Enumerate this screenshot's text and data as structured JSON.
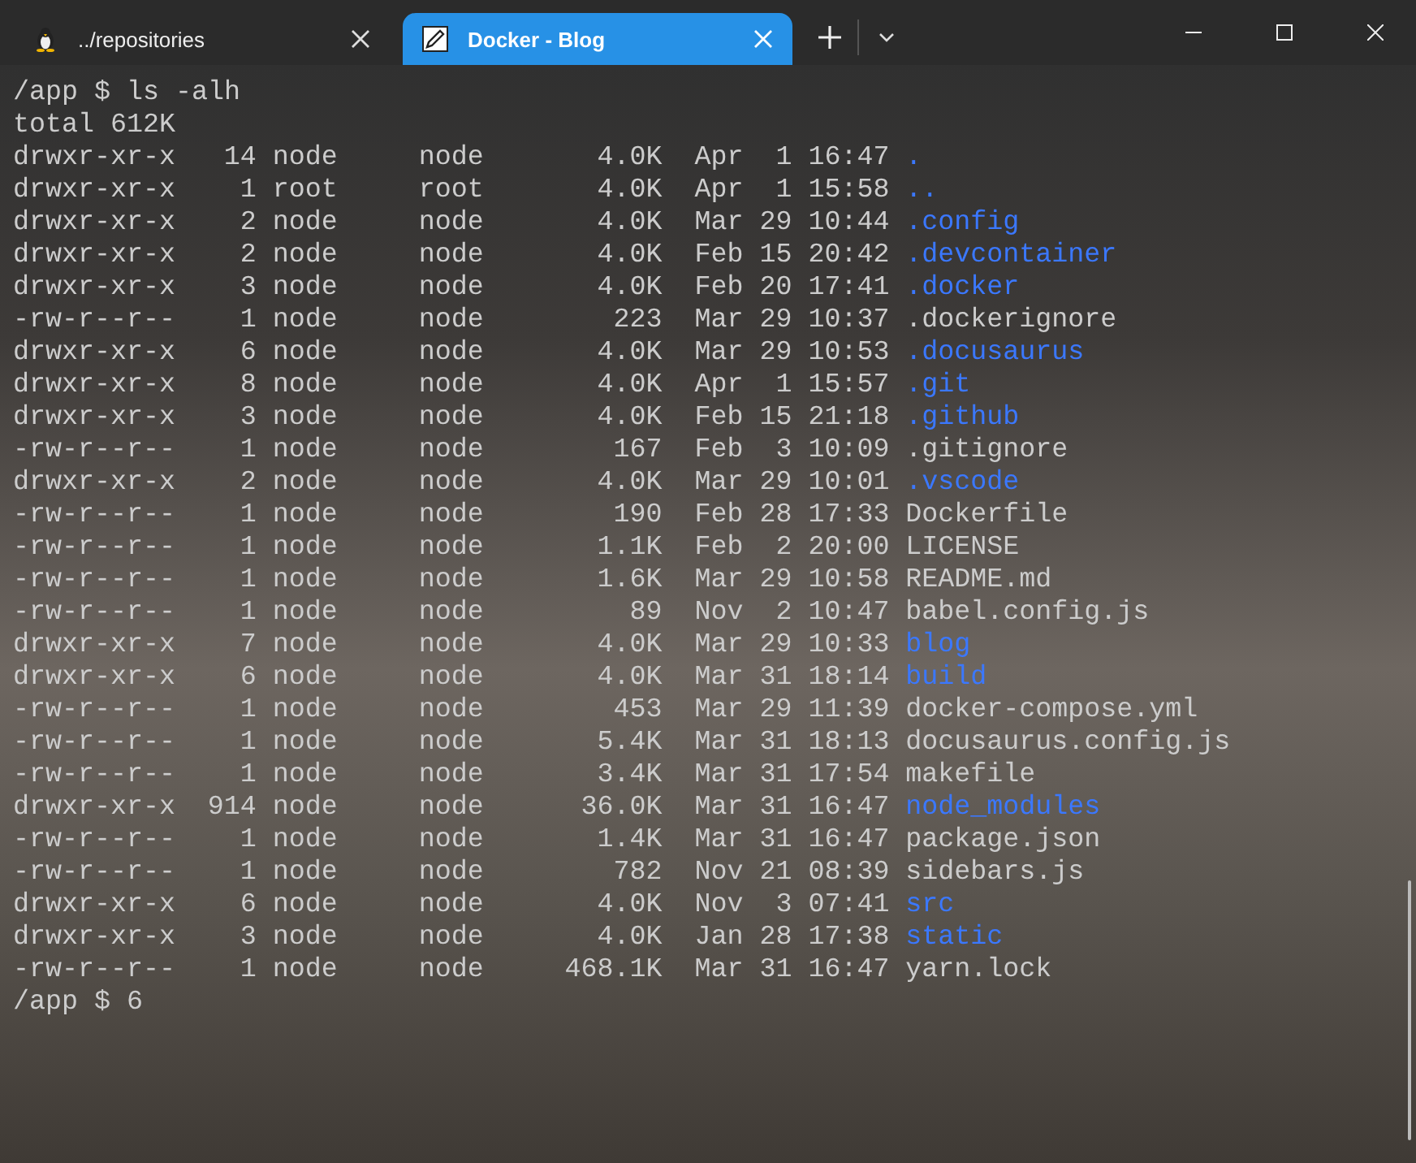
{
  "tabs": [
    {
      "title": "../repositories",
      "selected": false
    },
    {
      "title": "Docker - Blog",
      "selected": true
    }
  ],
  "terminal": {
    "command": "/app $ ls -alh",
    "total": "total 612K",
    "entries": [
      {
        "permissions": "drwxr-xr-x",
        "links": "14",
        "owner": "node",
        "group": "node",
        "size": "4.0K",
        "date": "Apr  1 16:47",
        "name": ".",
        "kind": "dir"
      },
      {
        "permissions": "drwxr-xr-x",
        "links": "1",
        "owner": "root",
        "group": "root",
        "size": "4.0K",
        "date": "Apr  1 15:58",
        "name": "..",
        "kind": "dir"
      },
      {
        "permissions": "drwxr-xr-x",
        "links": "2",
        "owner": "node",
        "group": "node",
        "size": "4.0K",
        "date": "Mar 29 10:44",
        "name": ".config",
        "kind": "dir"
      },
      {
        "permissions": "drwxr-xr-x",
        "links": "2",
        "owner": "node",
        "group": "node",
        "size": "4.0K",
        "date": "Feb 15 20:42",
        "name": ".devcontainer",
        "kind": "dir"
      },
      {
        "permissions": "drwxr-xr-x",
        "links": "3",
        "owner": "node",
        "group": "node",
        "size": "4.0K",
        "date": "Feb 20 17:41",
        "name": ".docker",
        "kind": "dir"
      },
      {
        "permissions": "-rw-r--r--",
        "links": "1",
        "owner": "node",
        "group": "node",
        "size": "223",
        "date": "Mar 29 10:37",
        "name": ".dockerignore",
        "kind": "file"
      },
      {
        "permissions": "drwxr-xr-x",
        "links": "6",
        "owner": "node",
        "group": "node",
        "size": "4.0K",
        "date": "Mar 29 10:53",
        "name": ".docusaurus",
        "kind": "dir"
      },
      {
        "permissions": "drwxr-xr-x",
        "links": "8",
        "owner": "node",
        "group": "node",
        "size": "4.0K",
        "date": "Apr  1 15:57",
        "name": ".git",
        "kind": "dir"
      },
      {
        "permissions": "drwxr-xr-x",
        "links": "3",
        "owner": "node",
        "group": "node",
        "size": "4.0K",
        "date": "Feb 15 21:18",
        "name": ".github",
        "kind": "dir"
      },
      {
        "permissions": "-rw-r--r--",
        "links": "1",
        "owner": "node",
        "group": "node",
        "size": "167",
        "date": "Feb  3 10:09",
        "name": ".gitignore",
        "kind": "file"
      },
      {
        "permissions": "drwxr-xr-x",
        "links": "2",
        "owner": "node",
        "group": "node",
        "size": "4.0K",
        "date": "Mar 29 10:01",
        "name": ".vscode",
        "kind": "dir"
      },
      {
        "permissions": "-rw-r--r--",
        "links": "1",
        "owner": "node",
        "group": "node",
        "size": "190",
        "date": "Feb 28 17:33",
        "name": "Dockerfile",
        "kind": "file"
      },
      {
        "permissions": "-rw-r--r--",
        "links": "1",
        "owner": "node",
        "group": "node",
        "size": "1.1K",
        "date": "Feb  2 20:00",
        "name": "LICENSE",
        "kind": "file"
      },
      {
        "permissions": "-rw-r--r--",
        "links": "1",
        "owner": "node",
        "group": "node",
        "size": "1.6K",
        "date": "Mar 29 10:58",
        "name": "README.md",
        "kind": "file"
      },
      {
        "permissions": "-rw-r--r--",
        "links": "1",
        "owner": "node",
        "group": "node",
        "size": "89",
        "date": "Nov  2 10:47",
        "name": "babel.config.js",
        "kind": "file"
      },
      {
        "permissions": "drwxr-xr-x",
        "links": "7",
        "owner": "node",
        "group": "node",
        "size": "4.0K",
        "date": "Mar 29 10:33",
        "name": "blog",
        "kind": "dir"
      },
      {
        "permissions": "drwxr-xr-x",
        "links": "6",
        "owner": "node",
        "group": "node",
        "size": "4.0K",
        "date": "Mar 31 18:14",
        "name": "build",
        "kind": "dir"
      },
      {
        "permissions": "-rw-r--r--",
        "links": "1",
        "owner": "node",
        "group": "node",
        "size": "453",
        "date": "Mar 29 11:39",
        "name": "docker-compose.yml",
        "kind": "file"
      },
      {
        "permissions": "-rw-r--r--",
        "links": "1",
        "owner": "node",
        "group": "node",
        "size": "5.4K",
        "date": "Mar 31 18:13",
        "name": "docusaurus.config.js",
        "kind": "file"
      },
      {
        "permissions": "-rw-r--r--",
        "links": "1",
        "owner": "node",
        "group": "node",
        "size": "3.4K",
        "date": "Mar 31 17:54",
        "name": "makefile",
        "kind": "file"
      },
      {
        "permissions": "drwxr-xr-x",
        "links": "914",
        "owner": "node",
        "group": "node",
        "size": "36.0K",
        "date": "Mar 31 16:47",
        "name": "node_modules",
        "kind": "dir"
      },
      {
        "permissions": "-rw-r--r--",
        "links": "1",
        "owner": "node",
        "group": "node",
        "size": "1.4K",
        "date": "Mar 31 16:47",
        "name": "package.json",
        "kind": "file"
      },
      {
        "permissions": "-rw-r--r--",
        "links": "1",
        "owner": "node",
        "group": "node",
        "size": "782",
        "date": "Nov 21 08:39",
        "name": "sidebars.js",
        "kind": "file"
      },
      {
        "permissions": "drwxr-xr-x",
        "links": "6",
        "owner": "node",
        "group": "node",
        "size": "4.0K",
        "date": "Nov  3 07:41",
        "name": "src",
        "kind": "dir"
      },
      {
        "permissions": "drwxr-xr-x",
        "links": "3",
        "owner": "node",
        "group": "node",
        "size": "4.0K",
        "date": "Jan 28 17:38",
        "name": "static",
        "kind": "dir"
      },
      {
        "permissions": "-rw-r--r--",
        "links": "1",
        "owner": "node",
        "group": "node",
        "size": "468.1K",
        "date": "Mar 31 16:47",
        "name": "yarn.lock",
        "kind": "file"
      }
    ],
    "prompt": "/app $ 6"
  }
}
